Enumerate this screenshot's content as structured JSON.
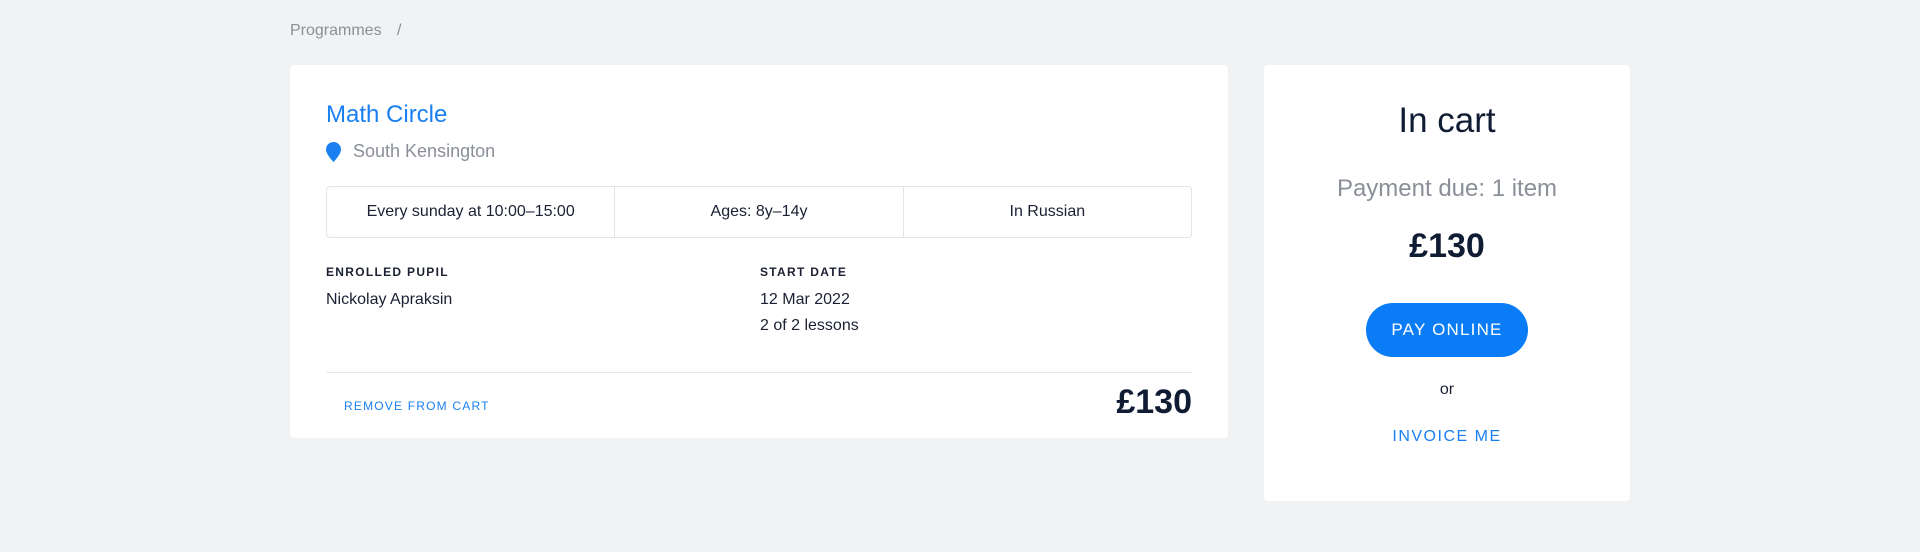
{
  "breadcrumb": {
    "items": [
      "Programmes"
    ],
    "separator": "/"
  },
  "program": {
    "title": "Math Circle",
    "location": "South Kensington",
    "location_icon": "location-pin-icon",
    "schedule": "Every sunday at 10:00–15:00",
    "ages": "Ages: 8y–14y",
    "language": "In Russian",
    "enrolled_pupil_label": "ENROLLED PUPIL",
    "enrolled_pupil": "Nickolay Apraksin",
    "start_date_label": "START DATE",
    "start_date": "12 Mar 2022",
    "lessons": "2 of 2 lessons",
    "remove_label": "REMOVE FROM CART",
    "price": "£130"
  },
  "cart": {
    "title": "In cart",
    "payment_due": "Payment due: 1 item",
    "total": "£130",
    "pay_label": "PAY ONLINE",
    "or_text": "or",
    "invoice_label": "INVOICE ME"
  },
  "colors": {
    "accent": "#1a7ff0",
    "button": "#0a7cf5",
    "background": "#f1f2f4",
    "muted_text": "#8a8f98",
    "dark_text": "#0f1c33"
  }
}
